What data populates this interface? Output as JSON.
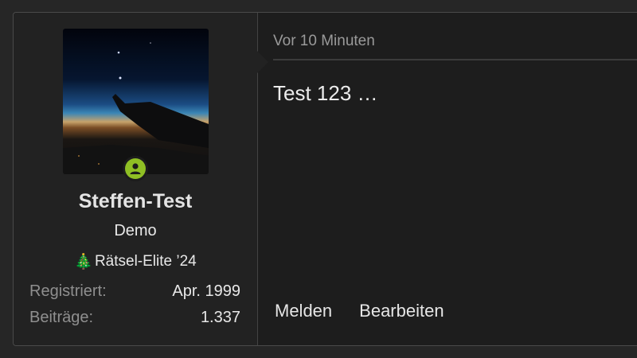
{
  "user": {
    "name": "Steffen-Test",
    "title": "Demo",
    "banner_emoji": "🎄",
    "banner": "Rätsel-Elite ’24",
    "online_status_color": "#8fbf24",
    "stats": [
      {
        "label": "Registriert:",
        "value": "Apr. 1999"
      },
      {
        "label": "Beiträge:",
        "value": "1.337"
      }
    ]
  },
  "post": {
    "timestamp": "Vor 10 Minuten",
    "message": "Test 123 …"
  },
  "actions": {
    "report": "Melden",
    "edit": "Bearbeiten"
  }
}
